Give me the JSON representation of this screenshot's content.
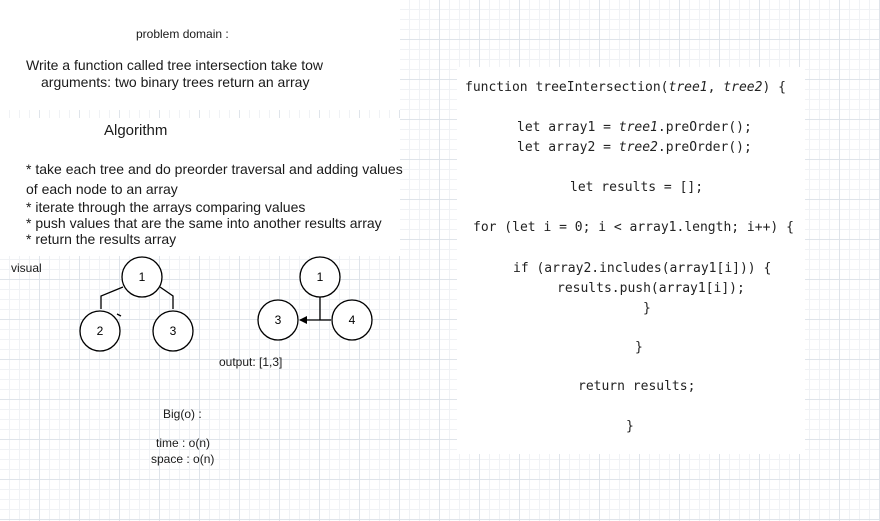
{
  "problem": {
    "heading": "problem domain :",
    "line1": "Write a function called tree intersection  take tow",
    "line2": "arguments: two binary trees  return an array"
  },
  "algorithm": {
    "heading": "Algorithm",
    "steps": [
      "* take each tree and do preorder traversal and adding values",
      "of each node to an array",
      "* iterate through the arrays comparing values",
      "* push values that are the same into another results array",
      "* return the results array"
    ]
  },
  "visual": {
    "label": "visual",
    "tree1": {
      "root": "1",
      "left": "2",
      "right": "3"
    },
    "tree2": {
      "root": "1",
      "left": "3",
      "right": "4"
    },
    "output": "output: [1,3]"
  },
  "bigo": {
    "heading": "Big(o) :",
    "time": "time : o(n)",
    "space": "space : o(n)"
  },
  "code": {
    "sig_prefix": "function treeIntersection(",
    "sig_param1": "tree1",
    "sig_sep": ", ",
    "sig_param2": "tree2",
    "sig_suffix": ") {",
    "l2_prefix": "let array1 = ",
    "l2_var": "tree1",
    "l2_suffix": ".preOrder();",
    "l3_prefix": "let array2 = ",
    "l3_var": "tree2",
    "l3_suffix": ".preOrder();",
    "l4": "let results = [];",
    "l5": "for (let i = 0; i < array1.length; i++) {",
    "l6": "if (array2.includes(array1[i])) {",
    "l7": "results.push(array1[i]);",
    "l8": "}",
    "l9": "}",
    "l10": "return results;",
    "l11": "}"
  }
}
